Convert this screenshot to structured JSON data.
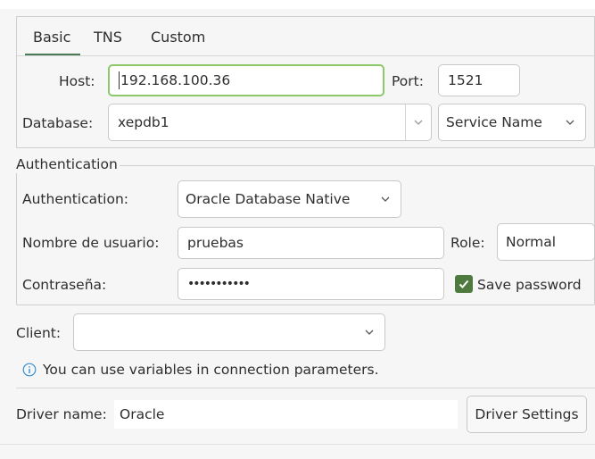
{
  "tabs": [
    "Basic",
    "TNS",
    "Custom"
  ],
  "connection": {
    "host_label": "Host:",
    "host_value": "192.168.100.36",
    "port_label": "Port:",
    "port_value": "1521",
    "database_label": "Database:",
    "database_value": "xepdb1",
    "service_type": "Service Name"
  },
  "authentication": {
    "group_title": "Authentication",
    "auth_label": "Authentication:",
    "auth_value": "Oracle Database Native",
    "username_label": "Nombre de usuario:",
    "username_value": "pruebas",
    "role_label": "Role:",
    "role_value": "Normal",
    "password_label": "Contraseña:",
    "password_value": "•••••••••••",
    "save_password_label": "Save password",
    "save_password_checked": true
  },
  "client": {
    "label": "Client:",
    "value": ""
  },
  "info_text": "You can use variables in connection parameters.",
  "driver": {
    "label": "Driver name:",
    "value": "Oracle",
    "settings_button": "Driver Settings"
  },
  "colors": {
    "accent": "#8dc96b",
    "tab_underline": "#4a7a55",
    "checkbox": "#4f7a3f",
    "info_icon": "#3a8fd0"
  }
}
